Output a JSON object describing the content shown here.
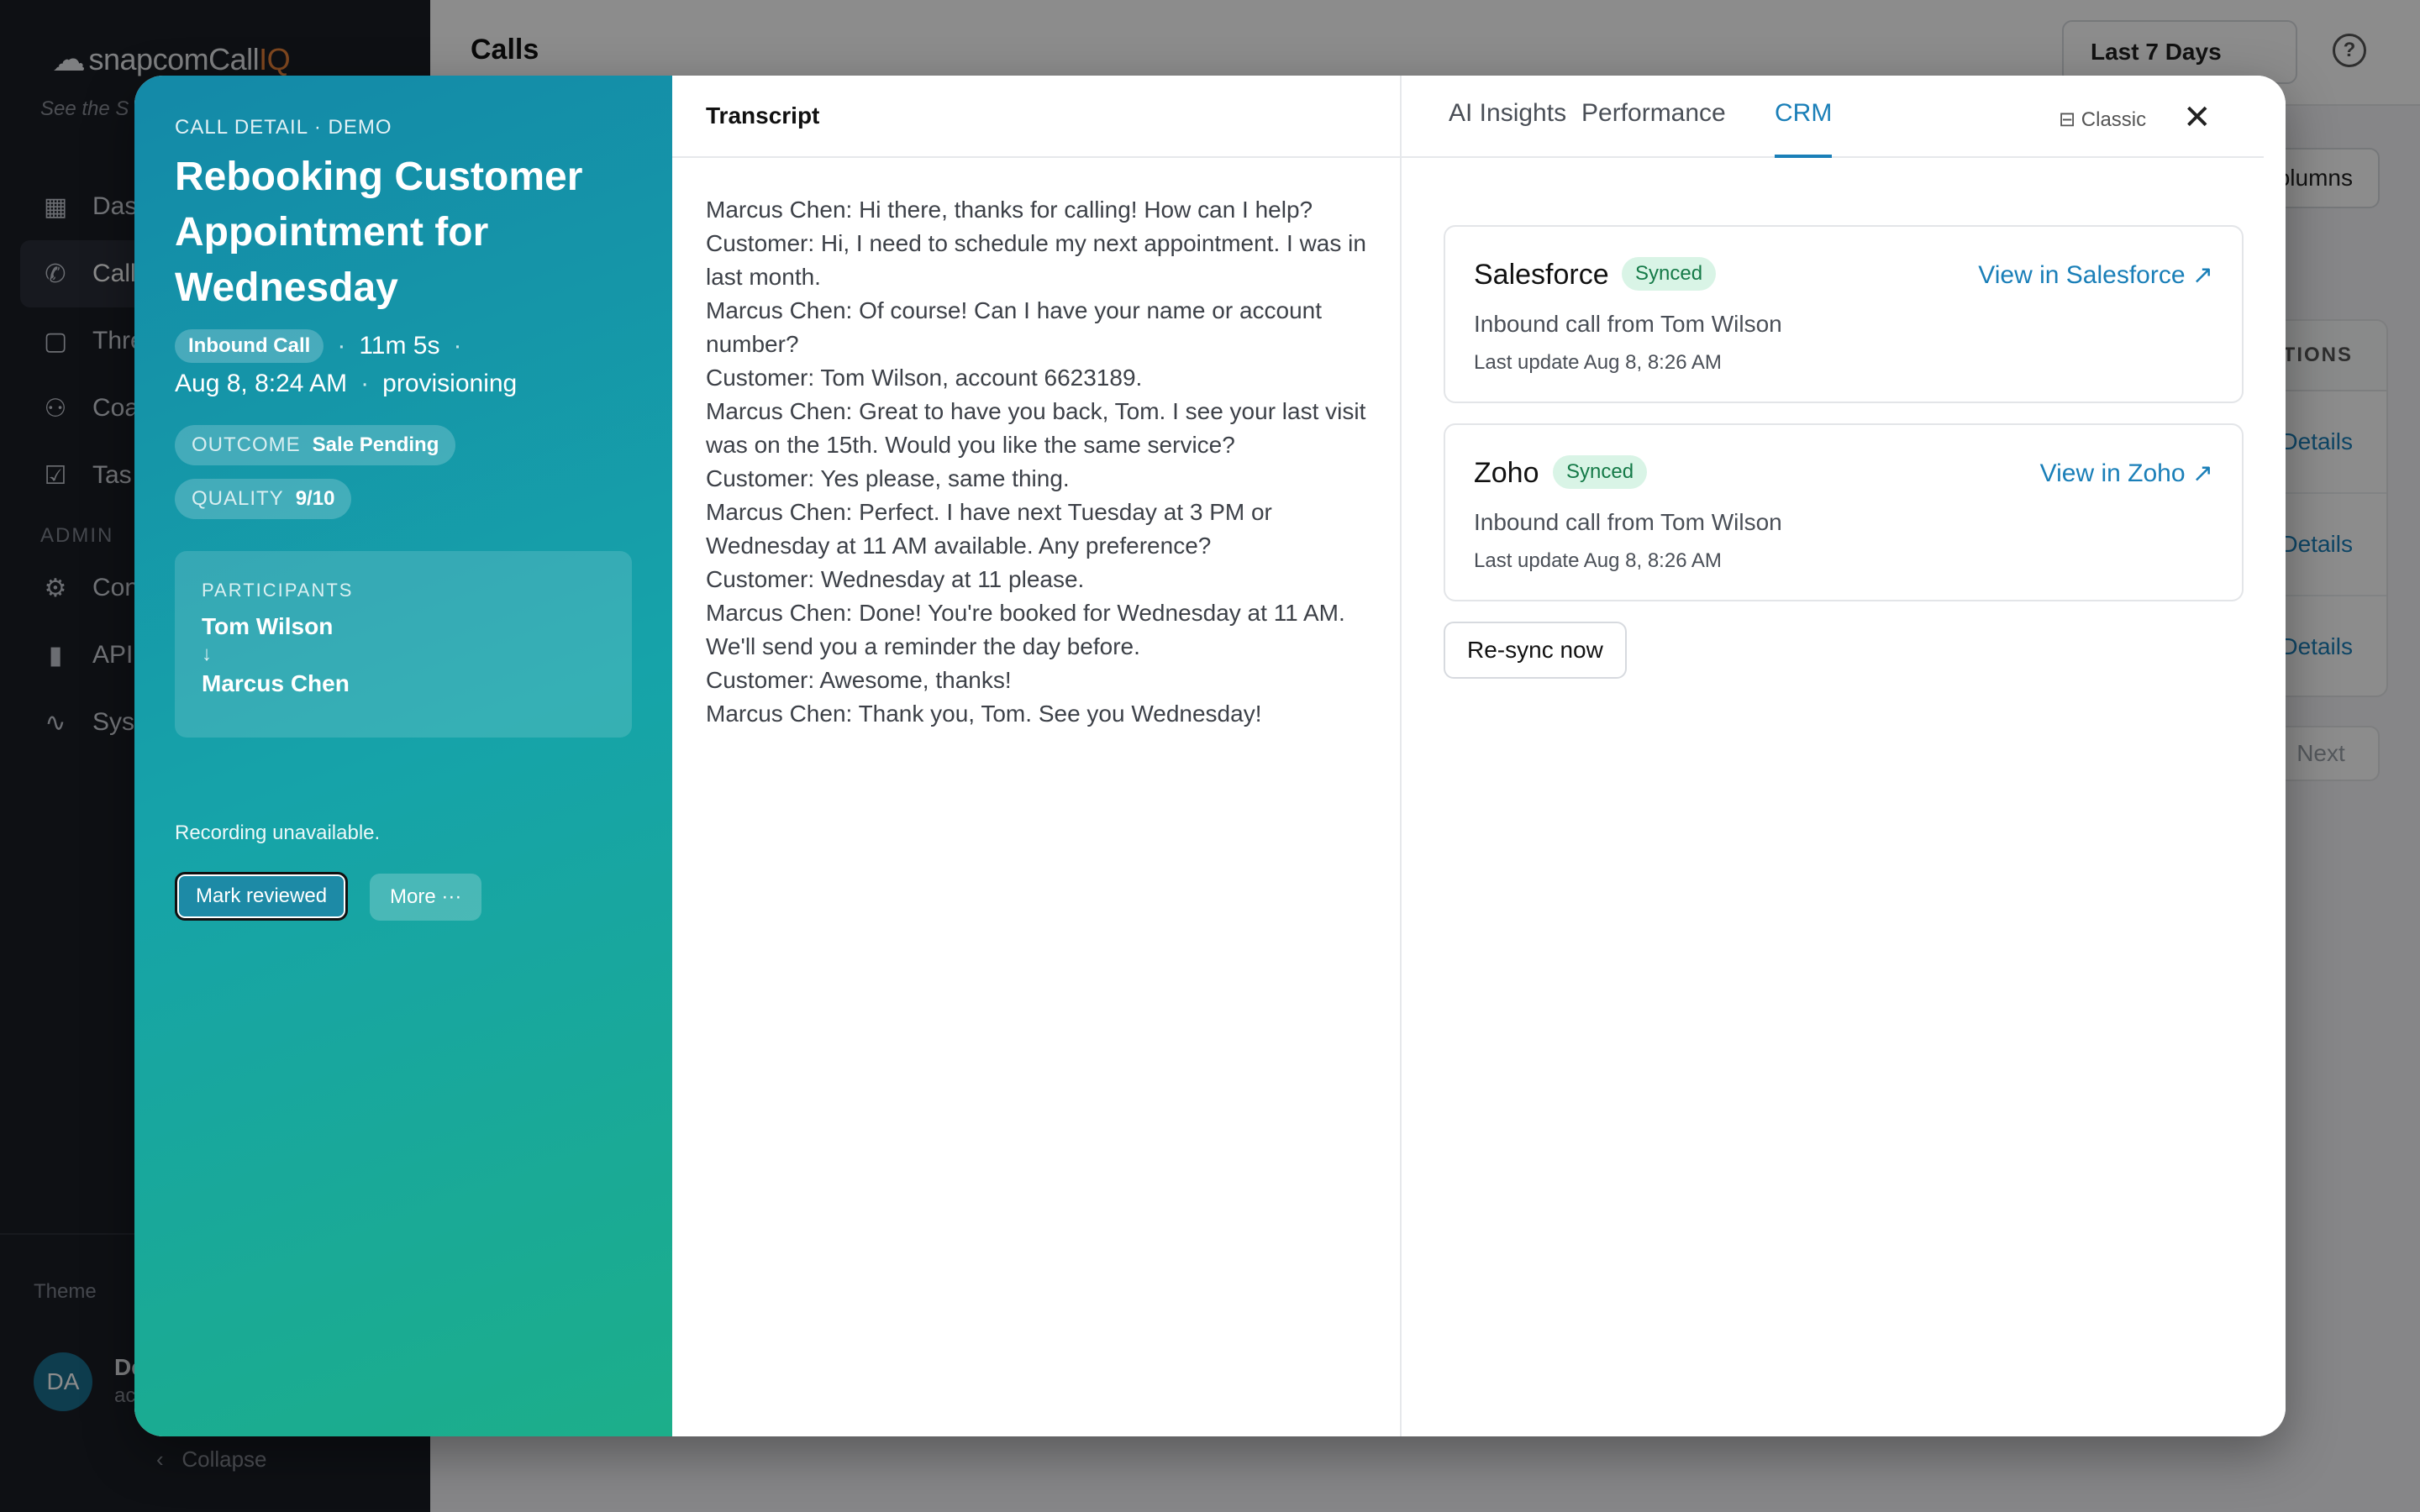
{
  "app": {
    "logo_brand": "snapcom",
    "logo_product_prefix": "Call",
    "logo_product_suffix": "IQ",
    "tagline": "See the S",
    "nav": [
      {
        "label": "Das",
        "icon": "grid-icon"
      },
      {
        "label": "Call",
        "icon": "phone-icon",
        "active": true
      },
      {
        "label": "Thre",
        "icon": "chat-icon"
      },
      {
        "label": "Coa",
        "icon": "users-icon"
      },
      {
        "label": "Tas",
        "icon": "checkbox-icon"
      }
    ],
    "admin_section": "ADMIN",
    "admin_nav": [
      {
        "label": "Con",
        "icon": "gear-icon"
      },
      {
        "label": "API",
        "icon": "bar-chart-icon"
      },
      {
        "label": "Syst",
        "icon": "activity-icon"
      }
    ],
    "theme_label": "Theme",
    "user": {
      "initials": "DA",
      "name": "De",
      "sub": "ac"
    },
    "collapse_label": "Collapse"
  },
  "main": {
    "title": "Calls",
    "date_range": "Last 7 Days",
    "help_icon": "?",
    "columns_button": "olumns",
    "table_header": "TIONS",
    "row_links": [
      "Details",
      "Details",
      "Details"
    ],
    "next_button": "Next"
  },
  "modal": {
    "eyebrow": "CALL DETAIL · DEMO",
    "title": "Rebooking Customer Appointment for Wednesday",
    "call_type": "Inbound Call",
    "duration": "11m 5s",
    "datetime": "Aug 8, 8:24 AM",
    "status": "provisioning",
    "outcome_label": "OUTCOME",
    "outcome_value": "Sale Pending",
    "quality_label": "QUALITY",
    "quality_value": "9/10",
    "participants_label": "PARTICIPANTS",
    "participant_from": "Tom Wilson",
    "participant_arrow": "↓",
    "participant_to": "Marcus Chen",
    "recording_text": "Recording unavailable.",
    "mark_reviewed": "Mark reviewed",
    "more": "More ···",
    "transcript_title": "Transcript",
    "transcript": [
      "Marcus Chen: Hi there, thanks for calling! How can I help?",
      "Customer: Hi, I need to schedule my next appointment. I was in last month.",
      "Marcus Chen: Of course! Can I have your name or account number?",
      "Customer: Tom Wilson, account 6623189.",
      "Marcus Chen: Great to have you back, Tom. I see your last visit was on the 15th. Would you like the same service?",
      "Customer: Yes please, same thing.",
      "Marcus Chen: Perfect. I have next Tuesday at 3 PM or Wednesday at 11 AM available. Any preference?",
      "Customer: Wednesday at 11 please.",
      "Marcus Chen: Done! You're booked for Wednesday at 11 AM. We'll send you a reminder the day before.",
      "Customer: Awesome, thanks!",
      "Marcus Chen: Thank you, Tom. See you Wednesday!"
    ],
    "tabs": [
      "AI Insights",
      "Performance",
      "CRM"
    ],
    "active_tab": "CRM",
    "classic_label": "⊟ Classic",
    "close_icon": "✕",
    "crm": [
      {
        "name": "Salesforce",
        "status": "Synced",
        "link": "View in Salesforce ↗",
        "description": "Inbound call from Tom Wilson",
        "updated": "Last update Aug 8, 8:26 AM"
      },
      {
        "name": "Zoho",
        "status": "Synced",
        "link": "View in Zoho ↗",
        "description": "Inbound call from Tom Wilson",
        "updated": "Last update Aug 8, 8:26 AM"
      }
    ],
    "resync_button": "Re-sync now"
  },
  "colors": {
    "accent": "#1a7fb8",
    "synced_bg": "#d9f4e6",
    "synced_text": "#157a48",
    "brand_orange": "#e7813a",
    "panel_gradient_start": "#1489a8",
    "panel_gradient_end": "#1cae8a"
  }
}
